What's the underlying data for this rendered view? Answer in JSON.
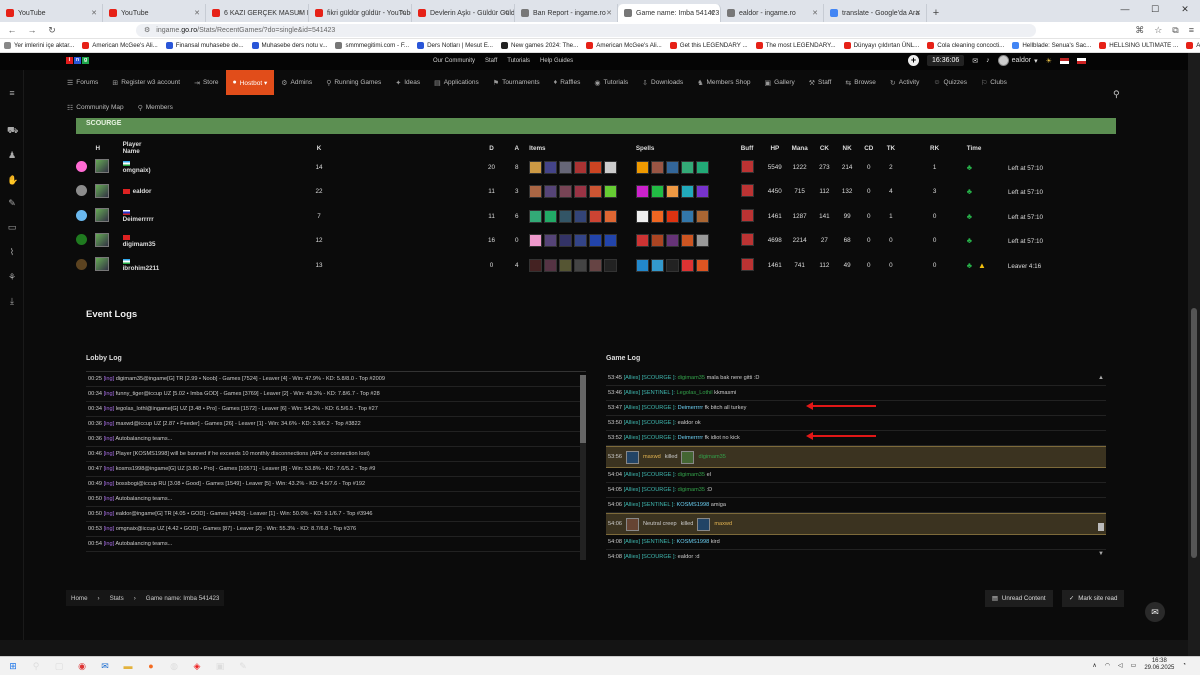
{
  "browser": {
    "tabs": [
      {
        "title": "YouTube",
        "color": "#e62117"
      },
      {
        "title": "YouTube",
        "color": "#e62117"
      },
      {
        "title": "6 KAZI GERÇEK MASUM KIM? |",
        "color": "#e62117"
      },
      {
        "title": "fikri güldür güldür - YouTube",
        "color": "#e62117"
      },
      {
        "title": "Devlerin Aşkı - Güldür Güldü",
        "color": "#e62117"
      },
      {
        "title": "Ban Report - ingame.ro",
        "color": "#777777"
      },
      {
        "title": "Game name: Imba 541423 - ing",
        "color": "#777777",
        "active": true
      },
      {
        "title": "ealdor - ingame.ro",
        "color": "#777777"
      },
      {
        "title": "translate - Google'da Ara",
        "color": "#4285f4"
      }
    ],
    "url_prefix": "ingame.",
    "url_domain": "go.ro",
    "url_path": "/Stats/RecentGames/?do=single&id=541423",
    "bookmarks": [
      "Yer imlerini içe aktar...",
      "American McGee's Ali...",
      "Finansal muhasebe de...",
      "Muhasebe ders notu v...",
      "smmmegitimi.com - F...",
      "Ders Notları | Mesut E...",
      "New games 2024: The...",
      "American McGee's Ali...",
      "Get this LEGENDARY ...",
      "The most LEGENDARY...",
      "Dünyayı çıldırtan ÜNL...",
      "Cola cleaning concocti...",
      "Hellblade: Senua's Sac...",
      "HELLSING ULTIMATE ...",
      "Another Top 10 Visuall..."
    ]
  },
  "site": {
    "top_links": [
      "Our Community",
      "Staff",
      "Tutorials",
      "Help Guides"
    ],
    "clock": "16:36:06",
    "username": "ealdor",
    "nav_row1": [
      {
        "label": "Forums",
        "icon": "☰"
      },
      {
        "label": "Register w3 account",
        "icon": "⊞"
      },
      {
        "label": "Store",
        "icon": "⇥"
      },
      {
        "label": "Hostbot ▾",
        "icon": "●",
        "active": true
      },
      {
        "label": "Admins",
        "icon": "⚙"
      },
      {
        "label": "Running Games",
        "icon": "⚲"
      },
      {
        "label": "Ideas",
        "icon": "✦"
      },
      {
        "label": "Applications",
        "icon": "▤"
      },
      {
        "label": "Tournaments",
        "icon": "⚑"
      },
      {
        "label": "Raffles",
        "icon": "♦"
      },
      {
        "label": "Tutorials",
        "icon": "◉"
      },
      {
        "label": "Downloads",
        "icon": "⇩"
      },
      {
        "label": "Members Shop",
        "icon": "♞"
      },
      {
        "label": "Gallery",
        "icon": "▣"
      },
      {
        "label": "Staff",
        "icon": "⚒"
      },
      {
        "label": "Browse",
        "icon": "⇆"
      },
      {
        "label": "Activity",
        "icon": "↻"
      },
      {
        "label": "Quizzes",
        "icon": "☺"
      },
      {
        "label": "Clubs",
        "icon": "⚐"
      }
    ],
    "nav_row2": [
      {
        "label": "Community Map",
        "icon": "☷"
      },
      {
        "label": "Members",
        "icon": "⚲"
      }
    ]
  },
  "team": "SCOURGE",
  "table": {
    "headers": [
      "H",
      "Player Name",
      "K",
      "D",
      "A",
      "Items",
      "Spells",
      "Buff",
      "HP",
      "Mana",
      "CK",
      "NK",
      "CD",
      "TK",
      "RK",
      "Time"
    ],
    "rows": [
      {
        "color": "#ff6bd3",
        "flag": "uz",
        "name": "omgnaix)",
        "k": "14",
        "d": "20",
        "a": "8",
        "hp": "5549",
        "mana": "1222",
        "ck": "273",
        "nk": "214",
        "cd": "0",
        "tk": "2",
        "rk": "1",
        "time": "Left at 57:10",
        "warn": false
      },
      {
        "color": "#8c8c8c",
        "flag": "tr",
        "name": "ealdor",
        "k": "22",
        "d": "11",
        "a": "3",
        "hp": "4450",
        "mana": "715",
        "ck": "112",
        "nk": "132",
        "cd": "0",
        "tk": "4",
        "rk": "3",
        "time": "Left at 57:10",
        "warn": false
      },
      {
        "color": "#6ab8ee",
        "flag": "ru",
        "name": "Deimerrrrr",
        "k": "7",
        "d": "11",
        "a": "6",
        "hp": "1461",
        "mana": "1287",
        "ck": "141",
        "nk": "99",
        "cd": "0",
        "tk": "1",
        "rk": "0",
        "time": "Left at 57:10",
        "warn": false
      },
      {
        "color": "#1f7a1f",
        "flag": "tr",
        "name": "digimam35",
        "k": "12",
        "d": "16",
        "a": "0",
        "hp": "4698",
        "mana": "2214",
        "ck": "27",
        "nk": "68",
        "cd": "0",
        "tk": "0",
        "rk": "0",
        "time": "Left at 57:10",
        "warn": false
      },
      {
        "color": "#5c4320",
        "flag": "uz",
        "name": "ibrohim2211",
        "k": "13",
        "d": "0",
        "a": "4",
        "hp": "1461",
        "mana": "741",
        "ck": "112",
        "nk": "49",
        "cd": "0",
        "tk": "0",
        "rk": "0",
        "time": "Leaver 4:16",
        "warn": true
      }
    ]
  },
  "event_logs_title": "Event Logs",
  "lobby_log_title": "Lobby Log",
  "game_log_title": "Game Log",
  "lobby_log": [
    {
      "time": "00:25",
      "tag": "[ing]",
      "text": "digimam35@ingame[G] TR [2.99 • Noob] - Games [7524] - Leaver [4] - Win: 47.9% - KD: 5.8/8.0 - Top #2009"
    },
    {
      "time": "00:34",
      "tag": "[ing]",
      "text": "funny_tiger@iccup UZ [5.02 • Imba GOD] - Games [3769] - Leaver [2] - Win: 49.3% - KD: 7.8/6.7 - Top #28"
    },
    {
      "time": "00:34",
      "tag": "[ing]",
      "text": "legolas_lothl@ingame[G] UZ [3.48 • Pro] - Games [1572] - Leaver [6] - Win: 54.2% - KD: 6.5/6.5 - Top #27"
    },
    {
      "time": "00:36",
      "tag": "[ing]",
      "text": "maxwd@iccup UZ [2.87 • Feeder] - Games [26] - Leaver [1] - Win: 34.6% - KD: 3.9/6.2 - Top #3822"
    },
    {
      "time": "00:36",
      "tag": "[ing]",
      "text": "Autobalancing teams..."
    },
    {
      "time": "00:46",
      "tag": "[ing]",
      "text": "Player [KOSMS1998] will be banned if he exceeds 10 monthly disconnections (AFK or connection lost)"
    },
    {
      "time": "00:47",
      "tag": "[ing]",
      "text": "kosms1998@ingame[G] UZ [3.80 • Pro] - Games [10571] - Leaver [8] - Win: 53.8% - KD: 7.6/5.2 - Top #9"
    },
    {
      "time": "00:49",
      "tag": "[ing]",
      "text": "bossbogi@iccup RU [3.08 • Good] - Games [1549] - Leaver [5] - Win: 43.2% - KD: 4.5/7.6 - Top #192"
    },
    {
      "time": "00:50",
      "tag": "[ing]",
      "text": "Autobalancing teams..."
    },
    {
      "time": "00:50",
      "tag": "[ing]",
      "text": "ealdor@ingame[G] TR [4.05 • GOD] - Games [4430] - Leaver [1] - Win: 50.0% - KD: 9.1/6.7 - Top #3946"
    },
    {
      "time": "00:53",
      "tag": "[ing]",
      "text": "omgnaix@iccup UZ [4.42 • GOD] - Games [87] - Leaver [2] - Win: 55.3% - KD: 8.7/6.8 - Top #376"
    },
    {
      "time": "00:54",
      "tag": "[ing]",
      "text": "Autobalancing teams..."
    }
  ],
  "game_log": [
    {
      "time": "53:45",
      "team": "[Allies] [SCOURGE ]:",
      "player": "digimam35",
      "pclass": "g",
      "msg": "mala bak nere gitti :D"
    },
    {
      "time": "53:46",
      "team": "[Allies] [SENTINEL ]:",
      "player": "Legolas_Lothil",
      "pclass": "g",
      "msg": "kkmasmi"
    },
    {
      "time": "53:47",
      "team": "[Allies] [SCOURGE ]:",
      "player": "Deimerrrrr",
      "pclass": "sent",
      "msg": "fk bitch all turkey",
      "arrow": true
    },
    {
      "time": "53:50",
      "team": "[Allies] [SCOURGE ]:",
      "player": "ealdor",
      "pclass": "plain",
      "msg": "ok"
    },
    {
      "time": "53:52",
      "team": "[Allies] [SCOURGE ]:",
      "player": "Deimerrrrr",
      "pclass": "sent",
      "msg": "fk idiot no kick",
      "arrow": true
    },
    {
      "time": "53:56",
      "kill": true,
      "killer": "maxwd",
      "verb": "killed",
      "victim": "digimam35"
    },
    {
      "time": "54:04",
      "team": "[Allies] [SCOURGE ]:",
      "player": "digimam35",
      "pclass": "g",
      "msg": "el"
    },
    {
      "time": "54:05",
      "team": "[Allies] [SCOURGE ]:",
      "player": "digimam35",
      "pclass": "g",
      "msg": ":D"
    },
    {
      "time": "54:06",
      "team": "[Allies] [SENTINEL ]:",
      "player": "KOSMS1998",
      "pclass": "sent",
      "msg": "amiga"
    },
    {
      "time": "54:06",
      "kill": true,
      "killer": "Neutral creep",
      "verb": "killed",
      "victim": "maxwd"
    },
    {
      "time": "54:08",
      "team": "[Allies] [SENTINEL ]:",
      "player": "KOSMS1998",
      "pclass": "sent",
      "msg": "kird"
    },
    {
      "time": "54:08",
      "team": "[Allies] [SCOURGE ]:",
      "player": "ealdor",
      "pclass": "plain",
      "msg": ":d"
    }
  ],
  "breadcrumb": [
    "Home",
    "Stats",
    "Game name: Imba 541423"
  ],
  "actions": {
    "unread": "Unread Content",
    "mark_read": "Mark site read"
  },
  "taskbar": {
    "time": "16:38",
    "date": "29.06.2025"
  }
}
